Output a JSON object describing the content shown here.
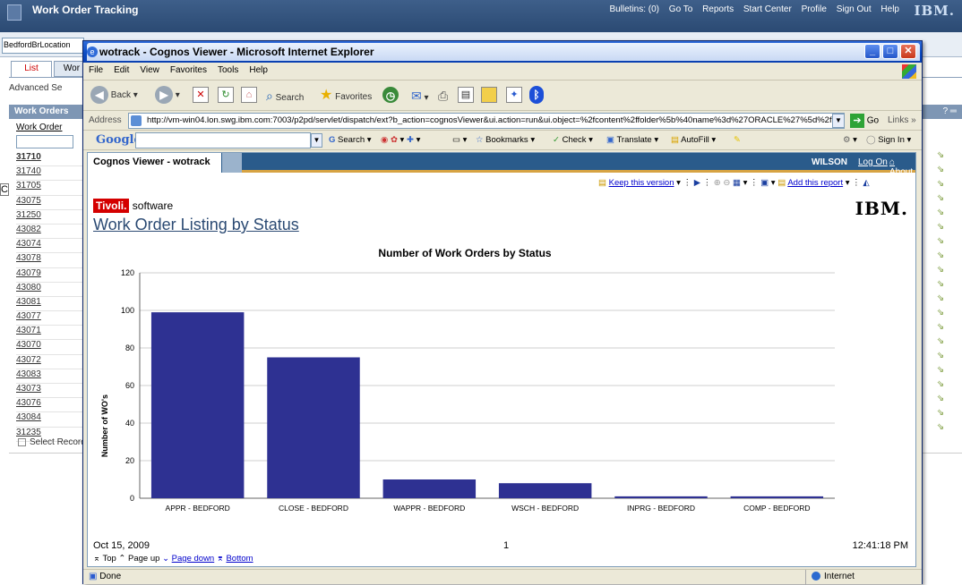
{
  "app": {
    "title": "Work Order Tracking",
    "links": [
      "Bulletins: (0)",
      "Go To",
      "Reports",
      "Start Center",
      "Profile",
      "Sign Out",
      "Help"
    ],
    "logo": "IBM.",
    "location_field": "BedfordBrLocation",
    "tabs": [
      "List",
      "Wor"
    ],
    "advanced_search": "Advanced Se",
    "table_title": "Work Orders",
    "column_header": "Work Order",
    "work_orders": [
      "31710",
      "31740",
      "31705",
      "43075",
      "31250",
      "43082",
      "43074",
      "43078",
      "43079",
      "43080",
      "43081",
      "43077",
      "43071",
      "43070",
      "43072",
      "43083",
      "43073",
      "43076",
      "43084",
      "31235"
    ],
    "select_records": "Select Record",
    "left_fragment": "C"
  },
  "ie": {
    "title": "wotrack - Cognos Viewer - Microsoft Internet Explorer",
    "menu": [
      "File",
      "Edit",
      "View",
      "Favorites",
      "Tools",
      "Help"
    ],
    "toolbar": {
      "back": "Back",
      "search": "Search",
      "favorites": "Favorites"
    },
    "address_label": "Address",
    "address_url": "http://vm-win04.lon.swg.ibm.com:7003/p2pd/servlet/dispatch/ext?b_action=cognosViewer&ui.action=run&ui.object=%2fcontent%2ffolder%5b%40name%3d%27ORACLE%27%5d%2fp",
    "go_label": "Go",
    "links_label": "Links",
    "google": {
      "logo": "Google",
      "items": [
        "Search",
        "Bookmarks",
        "Check",
        "Translate",
        "AutoFill",
        "Sign In"
      ]
    },
    "status": {
      "left": "Done",
      "zone": "Internet"
    }
  },
  "viewer": {
    "header_title": "Cognos Viewer - wotrack",
    "user": "WILSON",
    "log_on": "Log On",
    "about": "About",
    "keep_version": "Keep this version",
    "add_report": "Add this report",
    "tivoli_brand": "Tivoli.",
    "tivoli_software": "software",
    "ibm_logo": "IBM.",
    "report_title": "Work Order Listing by Status",
    "footer": {
      "date": "Oct 15, 2009",
      "page": "1",
      "time": "12:41:18 PM",
      "nav": [
        "Top",
        "Page up",
        "Page down",
        "Bottom"
      ]
    }
  },
  "chart_data": {
    "type": "bar",
    "title": "Number of Work Orders by Status",
    "ylabel": "Number of WO's",
    "xlabel": "",
    "categories": [
      "APPR - BEDFORD",
      "CLOSE - BEDFORD",
      "WAPPR - BEDFORD",
      "WSCH - BEDFORD",
      "INPRG - BEDFORD",
      "COMP - BEDFORD"
    ],
    "values": [
      99,
      75,
      10,
      8,
      1,
      1
    ],
    "ylim": [
      0,
      120
    ],
    "yticks": [
      0,
      20,
      40,
      60,
      80,
      100,
      120
    ],
    "grid": true,
    "bar_color": "#2e3192"
  }
}
